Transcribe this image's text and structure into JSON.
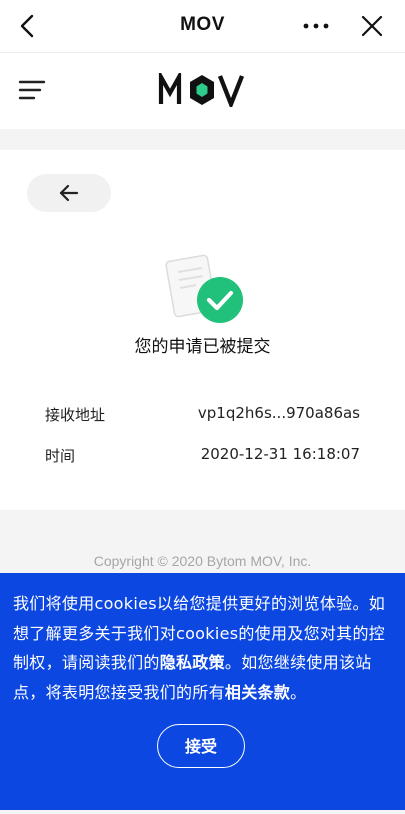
{
  "topbar": {
    "title": "MOV"
  },
  "header": {
    "logo_text": "MOV",
    "logo_accent": "#2fcb8b"
  },
  "result": {
    "status": "您的申请已被提交",
    "rows": [
      {
        "label": "接收地址",
        "value": "vp1q2h6s...970a86as"
      },
      {
        "label": "时间",
        "value": "2020-12-31 16:18:07"
      }
    ]
  },
  "footer": {
    "copyright": "Copyright © 2020 Bytom MOV, Inc."
  },
  "cookie": {
    "msg_1": "我们将使用cookies以给您提供更好的浏览体验。如想了解更多关于我们对cookies的使用及您对其的控制权，请阅读我们的",
    "privacy_link": "隐私政策",
    "msg_2": "。如您继续使用该站点，将表明您接受我们的所有",
    "terms_link": "相关条款",
    "msg_3": "。",
    "accept_label": "接受",
    "bg_color": "#0b47e0"
  }
}
